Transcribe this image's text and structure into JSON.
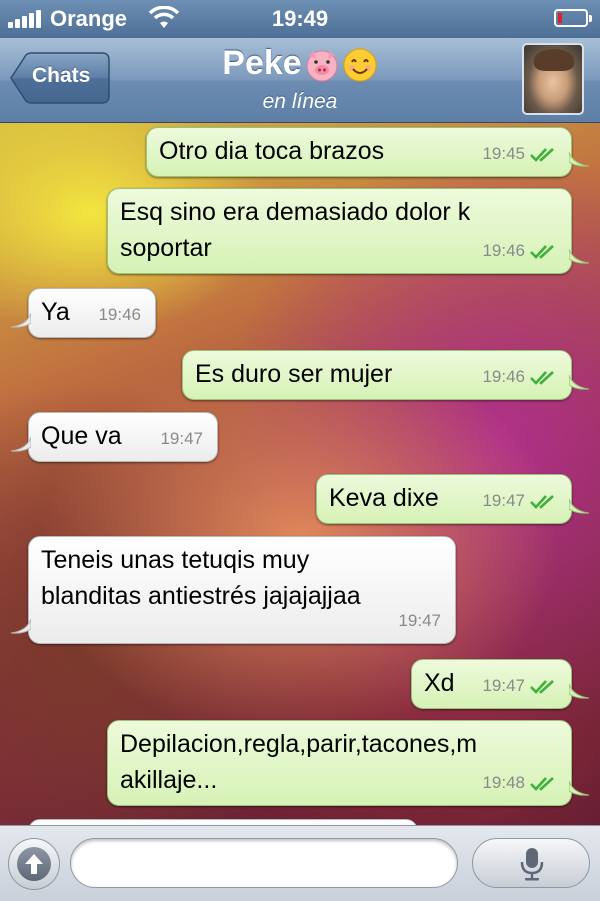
{
  "status_bar": {
    "carrier": "Orange",
    "time": "19:49",
    "signal_icon": "signal-bars-icon",
    "wifi_icon": "wifi-icon",
    "battery_icon": "battery-low-icon",
    "battery_color": "#e02020"
  },
  "nav": {
    "back_label": "Chats",
    "contact_name": "Peke",
    "contact_emoji": [
      "pig-face-icon",
      "smiling-face-icon"
    ],
    "contact_status": "en línea",
    "avatar_icon": "contact-avatar"
  },
  "colors": {
    "outgoing_bubble": "#dcf8c6",
    "incoming_bubble": "#ffffff",
    "read_ticks": "#3fb13a",
    "nav_bar": "#6c8cb2"
  },
  "messages": [
    {
      "direction": "out",
      "text": "Otro dia toca brazos",
      "time": "19:45",
      "ticks": "double-check-icon"
    },
    {
      "direction": "out",
      "text": "Esq sino era demasiado dolor k\nsoportar",
      "time": "19:46",
      "ticks": "double-check-icon"
    },
    {
      "direction": "in",
      "text": "Ya",
      "time": "19:46"
    },
    {
      "direction": "out",
      "text": "Es duro ser mujer",
      "time": "19:46",
      "ticks": "double-check-icon"
    },
    {
      "direction": "in",
      "text": "Que va",
      "time": "19:47"
    },
    {
      "direction": "out",
      "text": "Keva dixe",
      "time": "19:47",
      "ticks": "double-check-icon"
    },
    {
      "direction": "in",
      "text": "Teneis unas tetuqis muy\nblanditas antiestrés jajajajjaa",
      "time": "19:47"
    },
    {
      "direction": "out",
      "text": "Xd",
      "time": "19:47",
      "ticks": "double-check-icon"
    },
    {
      "direction": "out",
      "text": "Depilacion,regla,parir,tacones,m\nakillaje...",
      "time": "19:48",
      "ticks": "double-check-icon"
    }
  ],
  "input_bar": {
    "attach_icon": "arrow-up-circle-icon",
    "message_value": "",
    "mic_icon": "microphone-icon"
  }
}
